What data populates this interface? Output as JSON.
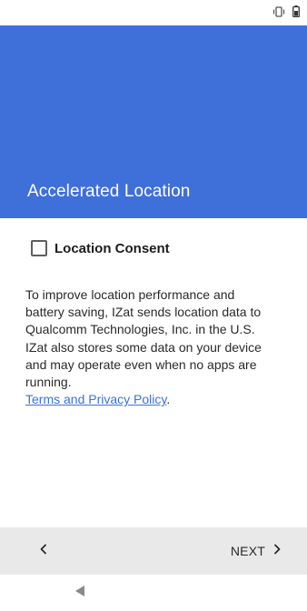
{
  "status_bar": {
    "icons": [
      "vibrate-icon",
      "battery-icon"
    ]
  },
  "header": {
    "title": "Accelerated Location",
    "background_color": "#3f6fd8"
  },
  "consent": {
    "label": "Location Consent",
    "checked": false
  },
  "body": {
    "lines": [
      "To improve location performance and",
      "battery saving, IZat sends location data to",
      "Qualcomm Technologies, Inc. in the U.S.",
      "IZat also stores some data on your device",
      "and may operate even when no apps are",
      "running."
    ],
    "link_text": "Terms and Privacy Policy",
    "link_suffix": "."
  },
  "footer": {
    "back_icon": "chevron-left-icon",
    "next_label": "NEXT",
    "next_icon": "chevron-right-icon"
  },
  "nav_bar": {
    "back_icon": "nav-back-triangle-icon"
  },
  "colors": {
    "accent": "#3f6fd8",
    "link": "#3b73d6",
    "footer_bg": "#e9e9e9"
  }
}
